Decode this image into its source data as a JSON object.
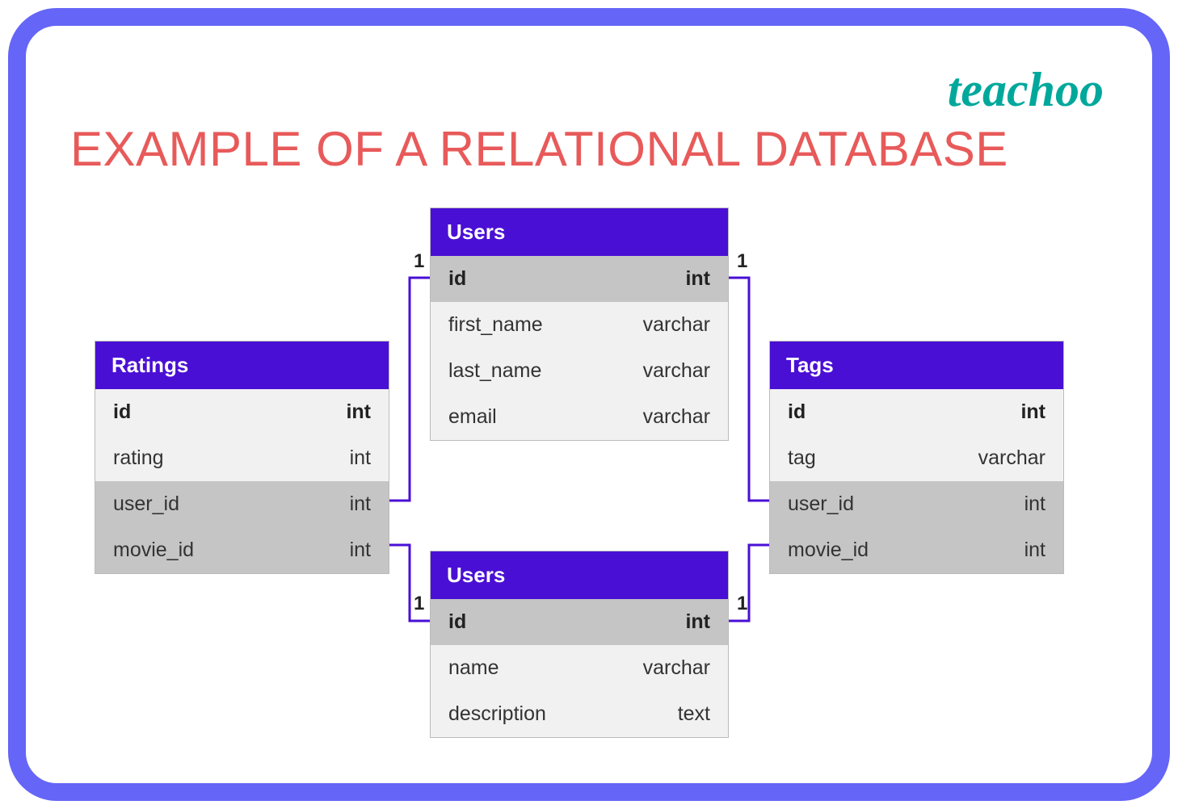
{
  "brand": "teachoo",
  "title": "EXAMPLE OF A RELATIONAL DATABASE",
  "tables": {
    "ratings": {
      "title": "Ratings",
      "rows": [
        {
          "name": "id",
          "type": "int",
          "bold": true,
          "shade": "light"
        },
        {
          "name": "rating",
          "type": "int",
          "bold": false,
          "shade": "light"
        },
        {
          "name": "user_id",
          "type": "int",
          "bold": false,
          "shade": "dark"
        },
        {
          "name": "movie_id",
          "type": "int",
          "bold": false,
          "shade": "dark"
        }
      ]
    },
    "users1": {
      "title": "Users",
      "rows": [
        {
          "name": "id",
          "type": "int",
          "bold": true,
          "shade": "dark"
        },
        {
          "name": "first_name",
          "type": "varchar",
          "bold": false,
          "shade": "light"
        },
        {
          "name": "last_name",
          "type": "varchar",
          "bold": false,
          "shade": "light"
        },
        {
          "name": "email",
          "type": "varchar",
          "bold": false,
          "shade": "light"
        }
      ]
    },
    "users2": {
      "title": "Users",
      "rows": [
        {
          "name": "id",
          "type": "int",
          "bold": true,
          "shade": "dark"
        },
        {
          "name": "name",
          "type": "varchar",
          "bold": false,
          "shade": "light"
        },
        {
          "name": "description",
          "type": "text",
          "bold": false,
          "shade": "light"
        }
      ]
    },
    "tags": {
      "title": "Tags",
      "rows": [
        {
          "name": "id",
          "type": "int",
          "bold": true,
          "shade": "light"
        },
        {
          "name": "tag",
          "type": "varchar",
          "bold": false,
          "shade": "light"
        },
        {
          "name": "user_id",
          "type": "int",
          "bold": false,
          "shade": "dark"
        },
        {
          "name": "movie_id",
          "type": "int",
          "bold": false,
          "shade": "dark"
        }
      ]
    }
  },
  "cardinalities": {
    "c1": "1",
    "c2": "1",
    "c3": "1",
    "c4": "1"
  }
}
